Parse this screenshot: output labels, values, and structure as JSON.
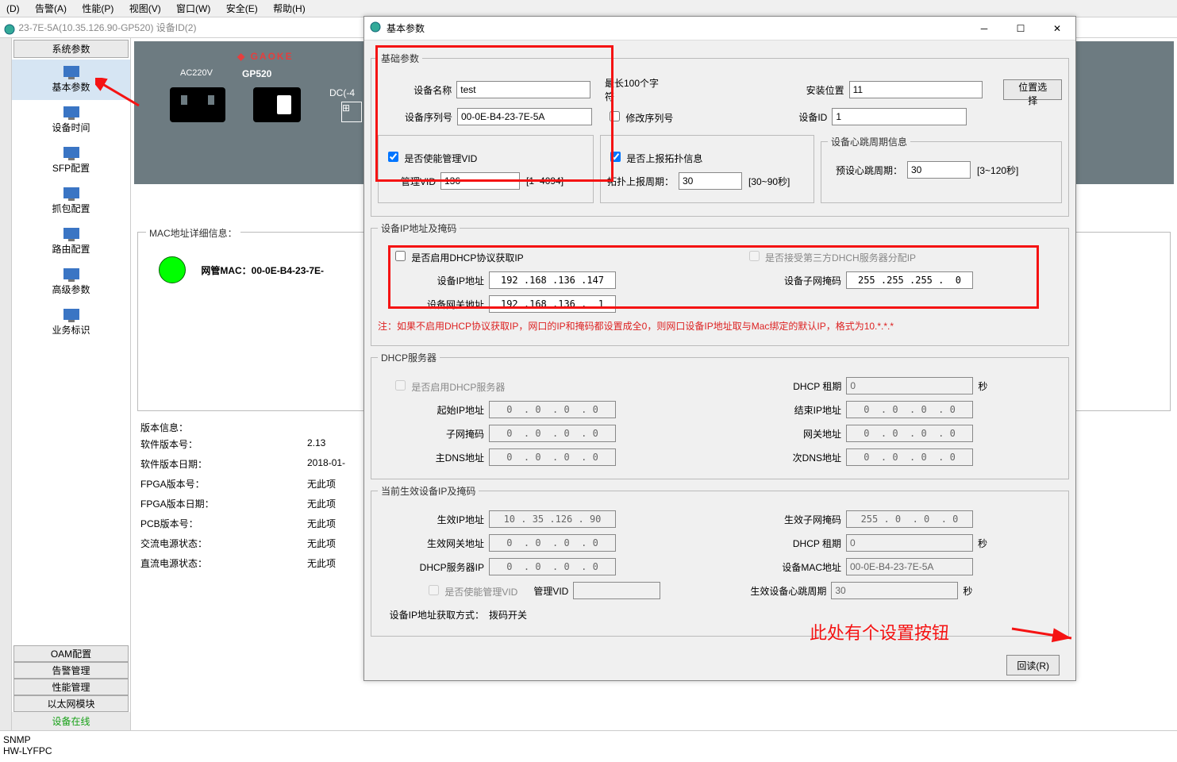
{
  "menu": {
    "items": [
      "(D)",
      "告警(A)",
      "性能(P)",
      "视图(V)",
      "窗口(W)",
      "安全(E)",
      "帮助(H)"
    ]
  },
  "mainwin": {
    "title": "23-7E-5A(10.35.126.90-GP520)  设备ID(2)"
  },
  "sidebar": {
    "header": "系统参数",
    "items": [
      {
        "label": "基本参数"
      },
      {
        "label": "设备时间"
      },
      {
        "label": "SFP配置"
      },
      {
        "label": "抓包配置"
      },
      {
        "label": "路由配置"
      },
      {
        "label": "高级参数"
      },
      {
        "label": "业务标识"
      }
    ],
    "bottom": [
      "OAM配置",
      "告警管理",
      "性能管理",
      "以太网模块"
    ],
    "status": "设备在线"
  },
  "device": {
    "logo": "GAOKE",
    "model": "GP520",
    "ac": "AC220V",
    "dc": "DC(-4"
  },
  "macbox": {
    "legend": "MAC地址详细信息：",
    "text": "网管MAC：00-0E-B4-23-7E-"
  },
  "ver": {
    "title": "版本信息：",
    "rows": [
      {
        "l": "软件版本号：",
        "v": "2.13"
      },
      {
        "l": "软件版本日期：",
        "v": "2018-01-"
      },
      {
        "l": "FPGA版本号：",
        "v": "无此项"
      },
      {
        "l": "FPGA版本日期：",
        "v": "无此项"
      },
      {
        "l": "PCB版本号：",
        "v": "无此项"
      },
      {
        "l": "交流电源状态：",
        "v": "无此项"
      },
      {
        "l": "直流电源状态：",
        "v": "无此项"
      }
    ]
  },
  "footer": {
    "l1": "SNMP",
    "l2": "HW-LYFPC"
  },
  "dlg": {
    "title": "基本参数",
    "basic": {
      "legend": "基础参数",
      "name_l": "设备名称",
      "name_v": "test",
      "name_hint": "最长100个字符",
      "install_l": "安装位置",
      "install_v": "11",
      "pos_btn": "位置选择",
      "sn_l": "设备序列号",
      "sn_v": "00-0E-B4-23-7E-5A",
      "modsn": "修改序列号",
      "devid_l": "设备ID",
      "devid_v": "1",
      "envid": "是否使能管理VID",
      "mvid_l": "管理VID",
      "mvid_v": "136",
      "mvid_range": "[1~4094]",
      "topo": "是否上报拓扑信息",
      "topo_l": "拓扑上报周期：",
      "topo_v": "30",
      "topo_range": "[30~90秒]",
      "hb_legend": "设备心跳周期信息",
      "hb_l": "预设心跳周期：",
      "hb_v": "30",
      "hb_range": "[3~120秒]"
    },
    "ip": {
      "legend": "设备IP地址及掩码",
      "dhcp": "是否启用DHCP协议获取IP",
      "accept3rd": "是否接受第三方DHCH服务器分配IP",
      "ip_l": "设备IP地址",
      "ip_v": "192 .168 .136 .147",
      "mask_l": "设备子网掩码",
      "mask_v": "255 .255 .255 .  0",
      "gw_l": "设备网关地址",
      "gw_v": "192 .168 .136 .  1",
      "note": "注：如果不启用DHCP协议获取IP，网口的IP和掩码都设置成全0，则网口设备IP地址取与Mac绑定的默认IP，格式为10.*.*.*"
    },
    "dhcpsrv": {
      "legend": "DHCP服务器",
      "en": "是否启用DHCP服务器",
      "lease_l": "DHCP 租期",
      "lease_v": "0",
      "sec": "秒",
      "start_l": "起始IP地址",
      "start_v": "0  . 0  . 0  . 0",
      "end_l": "结束IP地址",
      "end_v": "0  . 0  . 0  . 0",
      "mask_l": "子网掩码",
      "mask_v": "0  . 0  . 0  . 0",
      "gw_l": "网关地址",
      "gw_v": "0  . 0  . 0  . 0",
      "dns1_l": "主DNS地址",
      "dns1_v": "0  . 0  . 0  . 0",
      "dns2_l": "次DNS地址",
      "dns2_v": "0  . 0  . 0  . 0"
    },
    "cur": {
      "legend": "当前生效设备IP及掩码",
      "ip_l": "生效IP地址",
      "ip_v": "10 . 35 .126 . 90",
      "mask_l": "生效子网掩码",
      "mask_v": "255 . 0  . 0  . 0",
      "gw_l": "生效网关地址",
      "gw_v": "0  . 0  . 0  . 0",
      "lease_l": "DHCP 租期",
      "lease_v": "0",
      "sec": "秒",
      "srv_l": "DHCP服务器IP",
      "srv_v": "0  . 0  . 0  . 0",
      "mac_l": "设备MAC地址",
      "mac_v": "00-0E-B4-23-7E-5A",
      "envid": "是否使能管理VID",
      "mvid_l": "管理VID",
      "mvid_v": "",
      "hb_l": "生效设备心跳周期",
      "hb_v": "30",
      "mode_l": "设备IP地址获取方式：",
      "mode_v": "拨码开关"
    },
    "reread": "回读(R)"
  },
  "annot": {
    "text": "此处有个设置按钮"
  }
}
